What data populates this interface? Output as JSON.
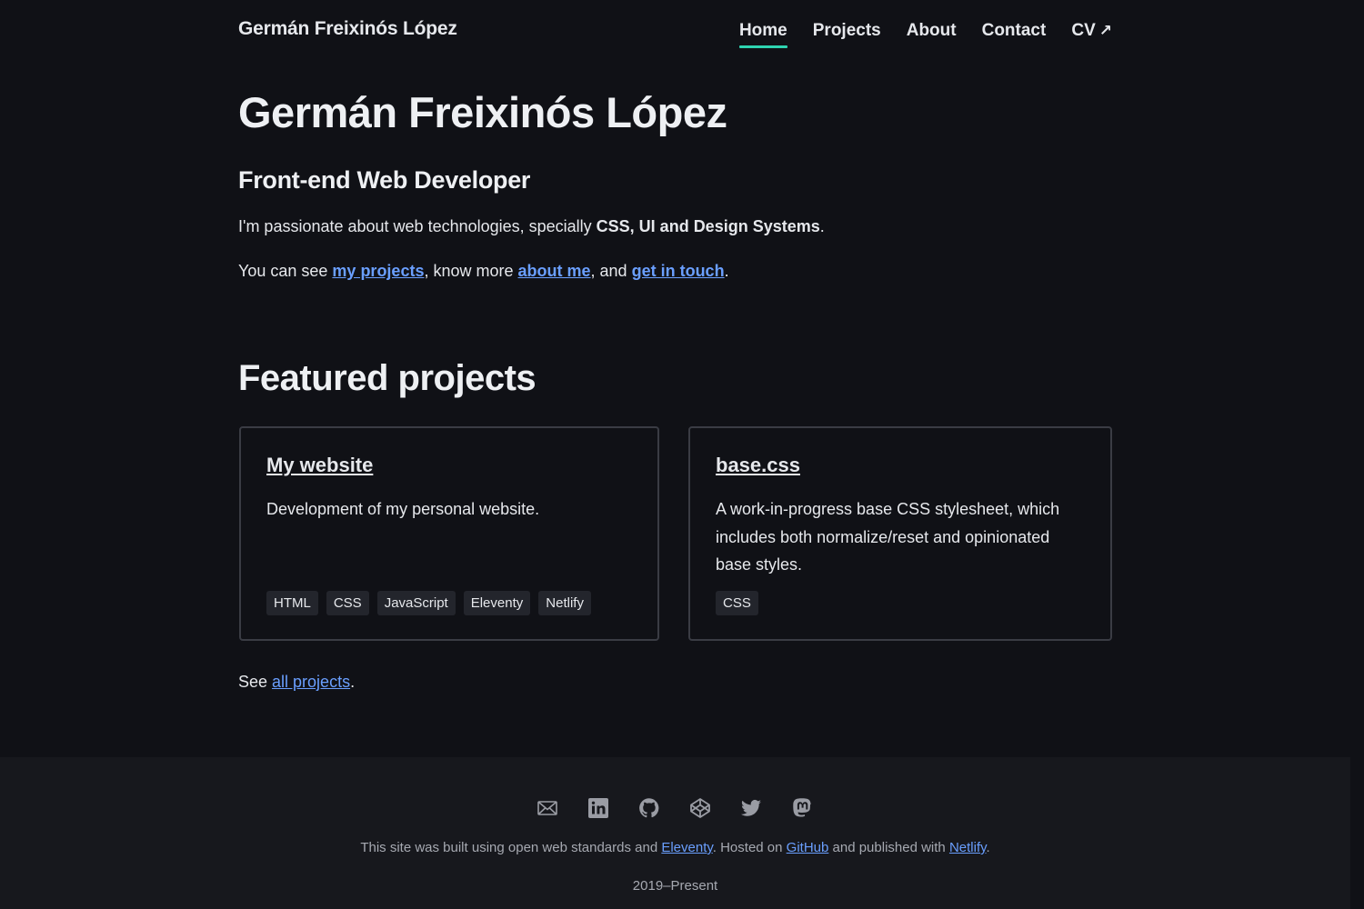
{
  "header": {
    "brand": "Germán Freixinós López",
    "nav": [
      {
        "label": "Home",
        "active": true
      },
      {
        "label": "Projects",
        "active": false
      },
      {
        "label": "About",
        "active": false
      },
      {
        "label": "Contact",
        "active": false
      },
      {
        "label": "CV",
        "active": false,
        "icon": "external-arrow-icon"
      }
    ],
    "accent": "#2ed3b0"
  },
  "hero": {
    "name": "Germán Freixinós López",
    "role": "Front-end Web Developer",
    "intro_prefix": "I'm passionate about web technologies, specially ",
    "intro_bold": "CSS, UI and Design Systems",
    "intro_suffix": ".",
    "links_prefix": "You can see ",
    "link_projects": "my projects",
    "links_mid1": ", know more ",
    "link_about": "about me",
    "links_mid2": ", and ",
    "link_contact": "get in touch",
    "links_suffix": "."
  },
  "featured": {
    "title": "Featured projects",
    "projects": [
      {
        "title": "My website",
        "description": "Development of my personal website.",
        "tags": [
          "HTML",
          "CSS",
          "JavaScript",
          "Eleventy",
          "Netlify"
        ]
      },
      {
        "title": "base.css",
        "description": "A work-in-progress base CSS stylesheet, which includes both normalize/reset and opinionated base styles.",
        "tags": [
          "CSS"
        ]
      }
    ],
    "see_prefix": "See ",
    "see_link": "all projects",
    "see_suffix": "."
  },
  "footer": {
    "socials": [
      "email-icon",
      "linkedin-icon",
      "github-icon",
      "codepen-icon",
      "twitter-icon",
      "mastodon-icon"
    ],
    "credits_prefix": "This site was built using open web standards and ",
    "credits_link1": "Eleventy",
    "credits_mid1": ". Hosted on ",
    "credits_link2": "GitHub",
    "credits_mid2": " and published with ",
    "credits_link3": "Netlify",
    "credits_suffix": ".",
    "years": "2019–Present"
  },
  "colors": {
    "background": "#101116",
    "footer_bg": "#17181d",
    "link": "#6a9fff",
    "tag_bg": "#23252c"
  }
}
